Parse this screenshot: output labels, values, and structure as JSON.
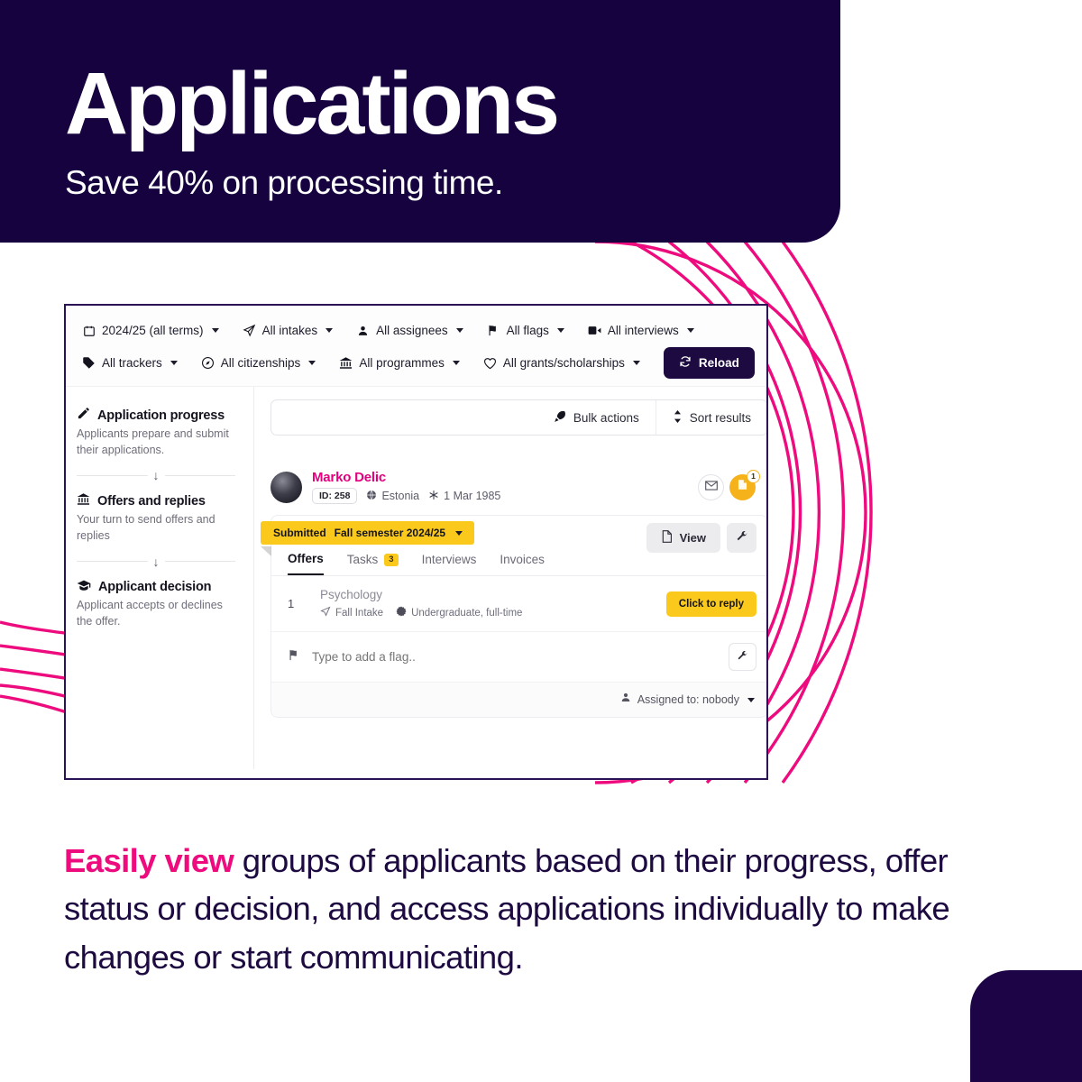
{
  "header": {
    "title": "Applications",
    "subtitle": "Save 40% on processing time."
  },
  "colors": {
    "navy": "#16023f",
    "pink": "#ed0b7e",
    "magenta": "#e5007d",
    "yellow": "#fbc91b",
    "amber": "#f5b21b"
  },
  "app": {
    "filters_row1": [
      {
        "icon": "calendar-icon",
        "label": "2024/25 (all terms)"
      },
      {
        "icon": "paper-plane-icon",
        "label": "All intakes"
      },
      {
        "icon": "person-icon",
        "label": "All assignees"
      },
      {
        "icon": "flag-icon",
        "label": "All flags"
      },
      {
        "icon": "video-camera-icon",
        "label": "All interviews"
      }
    ],
    "filters_row2": [
      {
        "icon": "tag-icon",
        "label": "All trackers"
      },
      {
        "icon": "compass-icon",
        "label": "All citizenships"
      },
      {
        "icon": "bank-icon",
        "label": "All programmes"
      },
      {
        "icon": "heart-icon",
        "label": "All grants/scholarships"
      }
    ],
    "reload_label": "Reload",
    "stages": [
      {
        "icon": "pencil-icon",
        "title": "Application progress",
        "desc": "Applicants prepare and submit their applications."
      },
      {
        "icon": "bank-icon",
        "title": "Offers and replies",
        "desc": "Your turn to send offers and replies"
      },
      {
        "icon": "graduation-cap-icon",
        "title": "Applicant decision",
        "desc": "Applicant accepts or declines the offer."
      }
    ],
    "toolbar": {
      "search_placeholder": "",
      "bulk_actions": "Bulk actions",
      "sort_results": "Sort results"
    },
    "applicant": {
      "name": "Marko Delic",
      "id": "ID: 258",
      "country": "Estonia",
      "birthdate": "1 Mar 1985",
      "mail_badge": "1"
    },
    "card": {
      "status": "Submitted",
      "term": "Fall semester 2024/25",
      "view_label": "View",
      "tabs": [
        {
          "label": "Offers",
          "badge": "",
          "active": true
        },
        {
          "label": "Tasks",
          "badge": "3",
          "active": false
        },
        {
          "label": "Interviews",
          "badge": "",
          "active": false
        },
        {
          "label": "Invoices",
          "badge": "",
          "active": false
        }
      ],
      "offer": {
        "num": "1",
        "title": "Psychology",
        "intake": "Fall Intake",
        "level": "Undergraduate, full-time",
        "reply_label": "Click to reply"
      },
      "flag_placeholder": "Type to add a flag..",
      "assigned_to": "Assigned to: nobody"
    }
  },
  "caption": {
    "highlight": "Easily view",
    "rest": " groups of applicants based on their progress, offer status or decision, and access applications individually to make changes or start communicating."
  }
}
